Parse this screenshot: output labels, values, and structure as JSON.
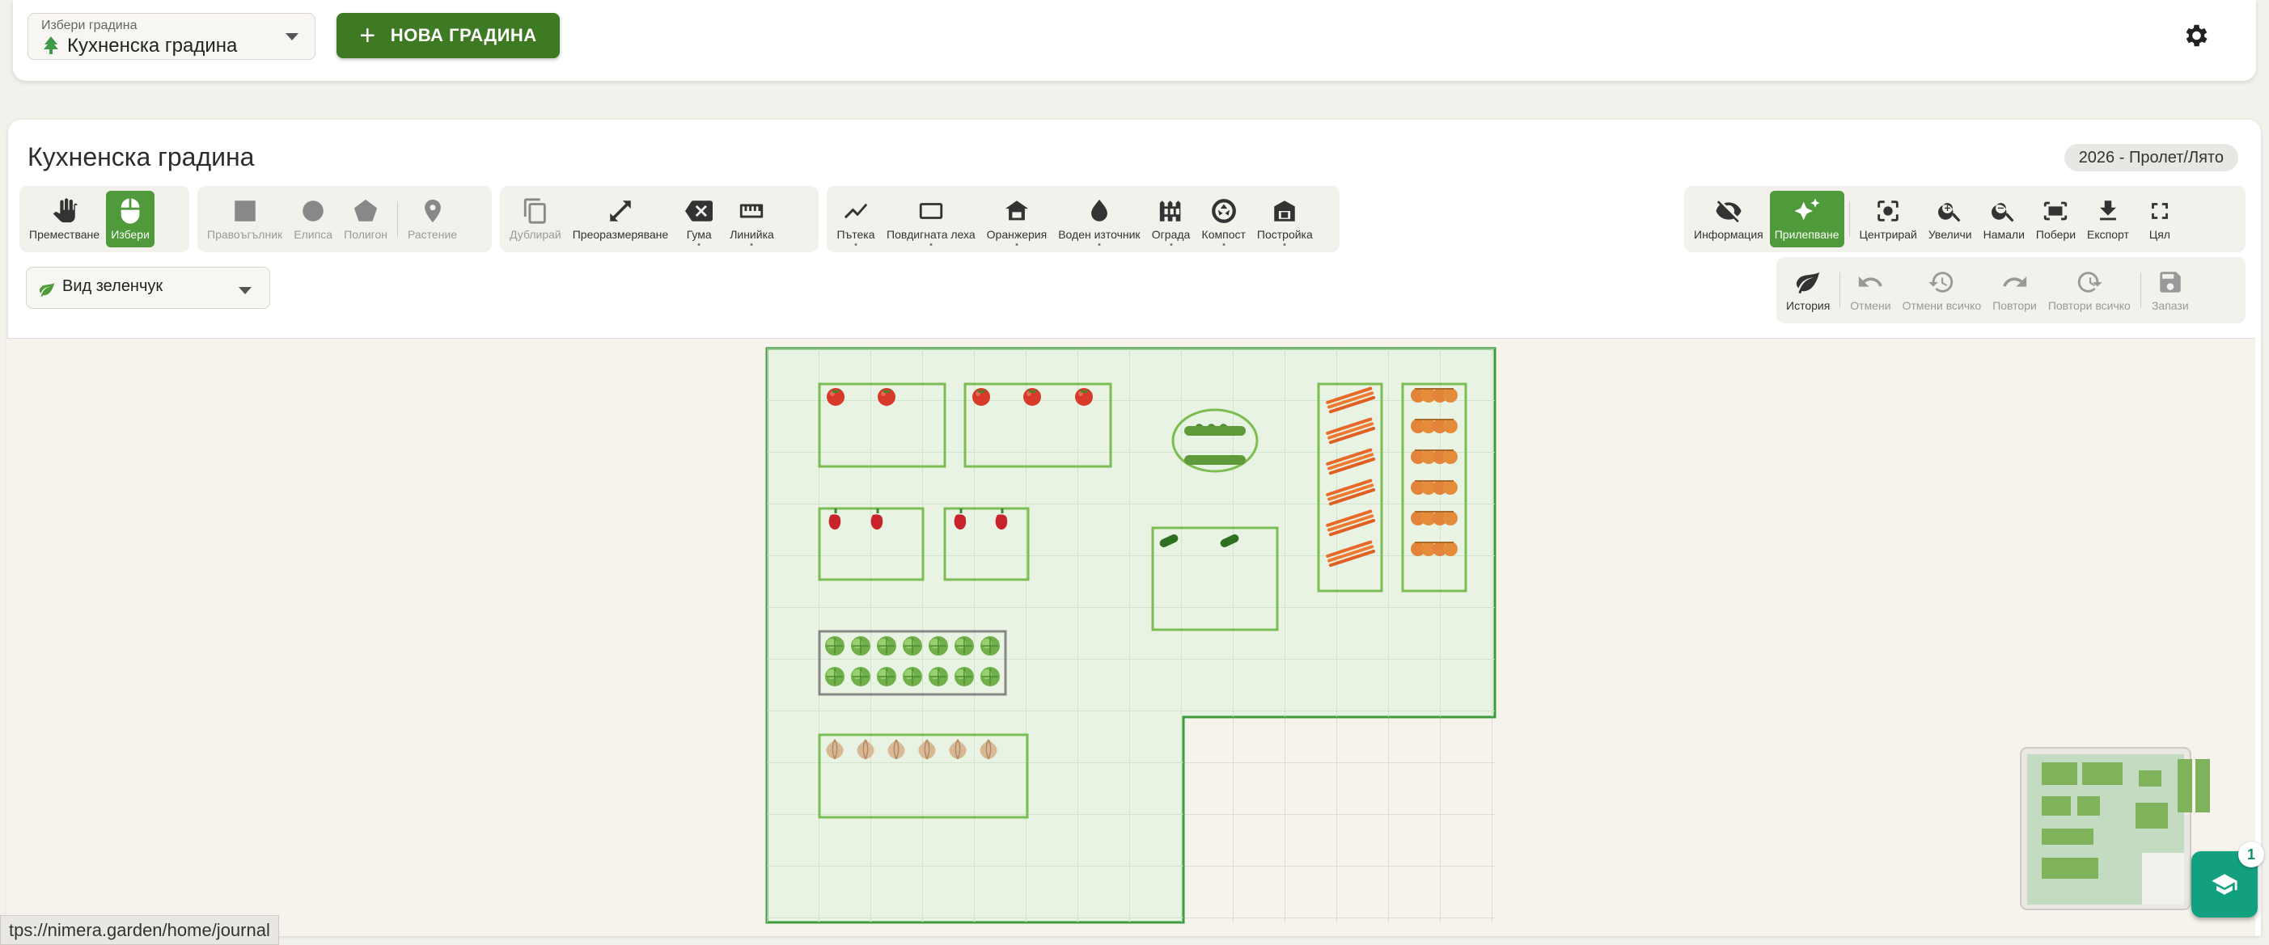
{
  "header": {
    "garden_select_label": "Избери градина",
    "garden_select_value": "Кухненска градина",
    "new_garden_label": "НОВА ГРАДИНА"
  },
  "panel": {
    "title": "Кухненска градина",
    "season": "2026 - Пролет/Лято"
  },
  "toolbar": {
    "mode": [
      "Преместване",
      "Избери"
    ],
    "shapes": [
      "Правоъгълник",
      "Елипса",
      "Полигон",
      "Растение"
    ],
    "edit": [
      "Дублирай",
      "Преоразмеряване",
      "Гума",
      "Линийка"
    ],
    "structures": [
      "Пътека",
      "Повдигната леха",
      "Оранжерия",
      "Воден източник",
      "Ограда",
      "Компост",
      "Постройка"
    ],
    "view": [
      "Информация",
      "Прилепване",
      "Центрирай",
      "Увеличи",
      "Намали",
      "Побери",
      "Експорт",
      "Цял"
    ],
    "history": [
      "История",
      "Отмени",
      "Отмени всичко",
      "Повтори",
      "Повтори всичко",
      "Запази"
    ]
  },
  "veg_select_value": "Вид зеленчук",
  "status_url": "tps://nimera.garden/home/journal",
  "help_badge": "1",
  "colors": {
    "brand_green": "#3e7a23",
    "active_green": "#4f9a3a",
    "garden_fill": "#e8f3e4",
    "garden_border": "#3d9a3d",
    "bed_border": "#7cbd52",
    "help_teal": "#13a07f"
  },
  "icons": {
    "garden": "tree-icon",
    "settings": "gear-icon",
    "help": "graduation-cap-icon",
    "plants": [
      "tomato-icon",
      "pepper-icon",
      "lettuce-icon",
      "onion-icon",
      "cucumber-icon",
      "carrot-icon",
      "bean-icon"
    ]
  }
}
